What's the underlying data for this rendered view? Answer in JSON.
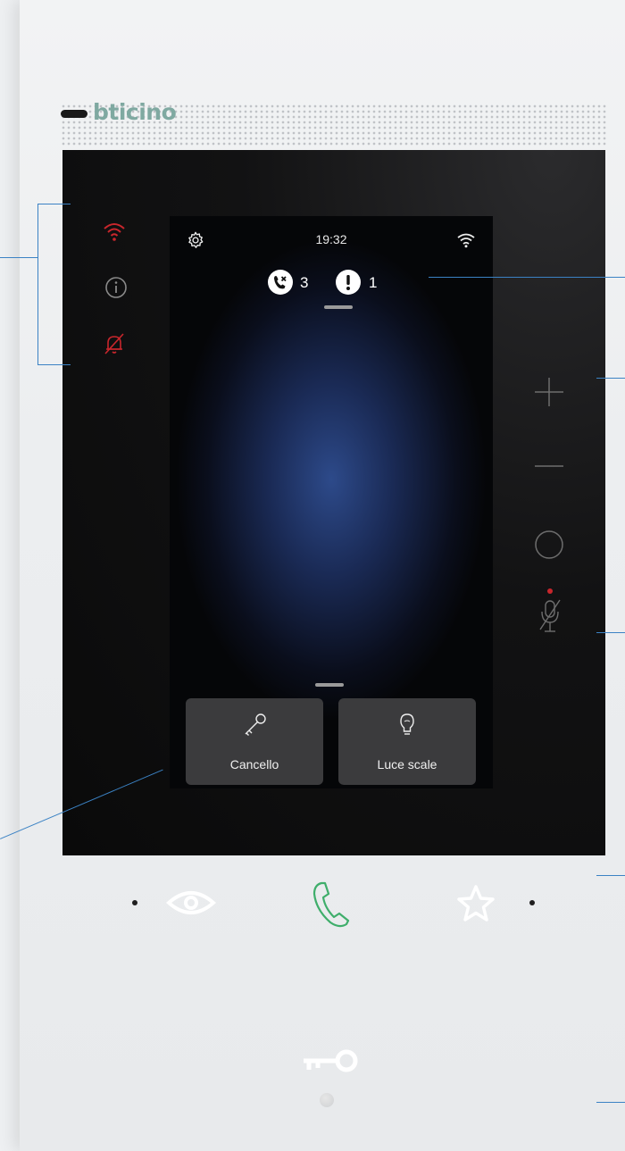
{
  "brand": {
    "name": "bticino"
  },
  "screen": {
    "time": "19:32",
    "notifications": [
      {
        "icon": "missed-call-icon",
        "count": "3"
      },
      {
        "icon": "alert-icon",
        "count": "1"
      }
    ],
    "shortcuts": [
      {
        "icon": "key-icon",
        "label": "Cancello"
      },
      {
        "icon": "bulb-icon",
        "label": "Luce scale"
      }
    ]
  },
  "indicators": [
    "wifi-status-icon",
    "info-icon",
    "bell-muted-icon"
  ],
  "side_controls": [
    "plus-button",
    "minus-button",
    "circle-button",
    "mic-muted-button"
  ],
  "bottom_controls": [
    "eye-button",
    "handset-button",
    "star-button",
    "key-button"
  ],
  "colors": {
    "accent_red": "#c8262c",
    "handset_green": "#3fae6b",
    "callout_blue": "#3b82c4",
    "brand_teal": "#7fa9a1"
  }
}
